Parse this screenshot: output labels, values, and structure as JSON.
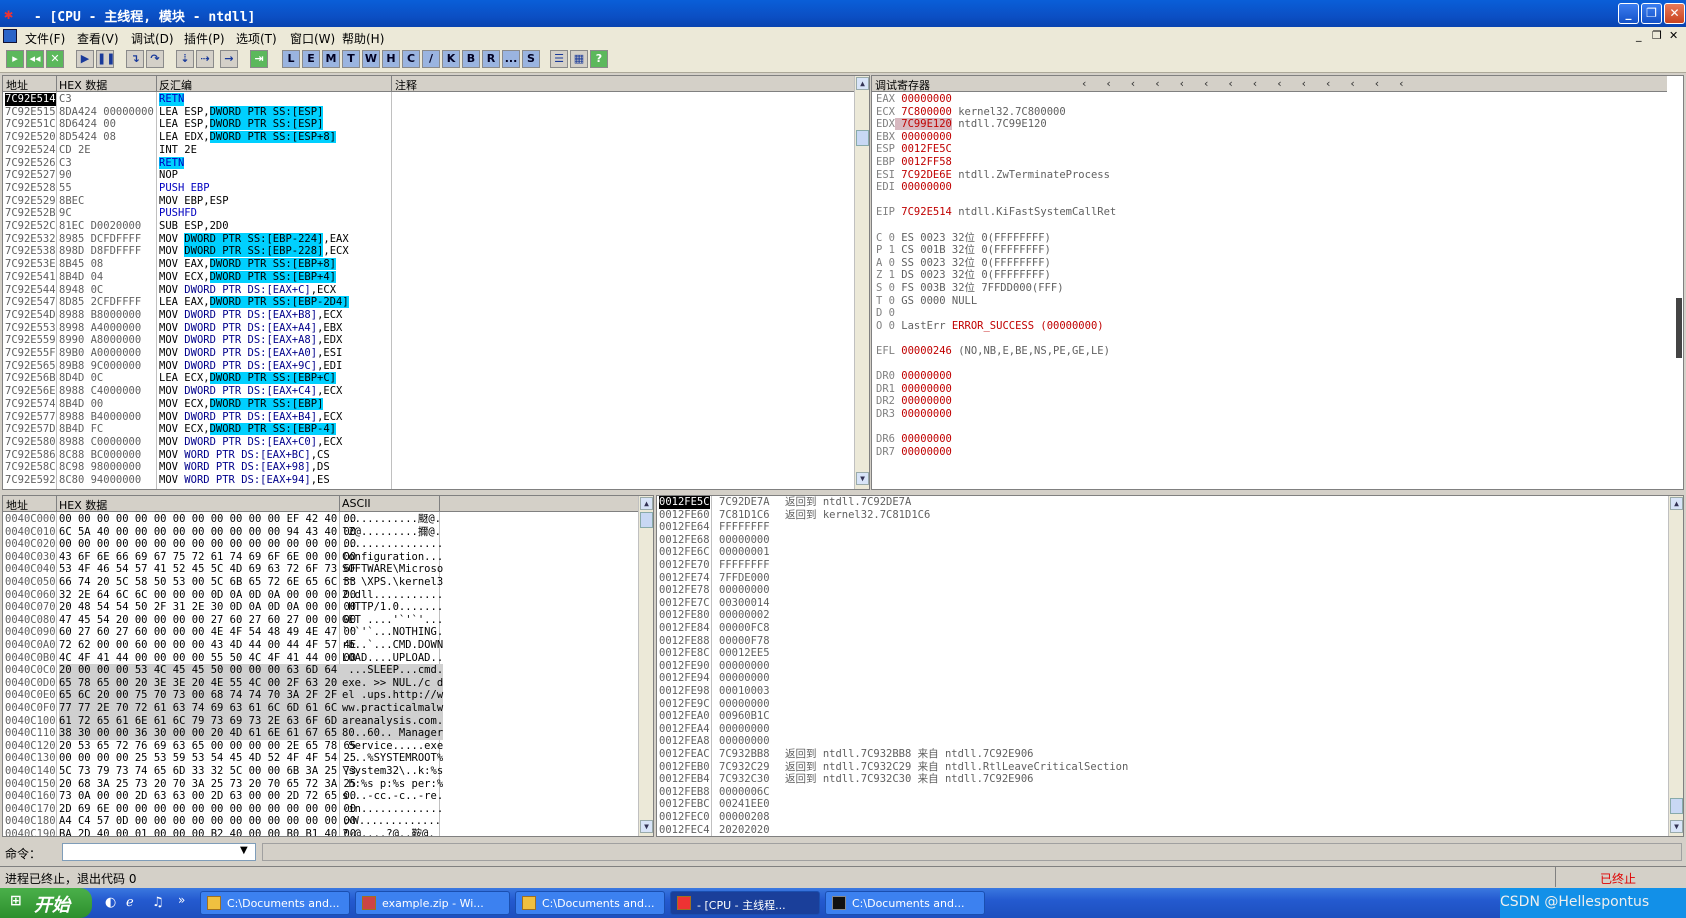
{
  "window": {
    "title": " - [CPU - 主线程, 模块 - ntdll]"
  },
  "menu": [
    "文件(F)",
    "查看(V)",
    "调试(D)",
    "插件(P)",
    "选项(T)",
    "窗口(W)",
    "帮助(H)"
  ],
  "toolbar_letters": [
    "L",
    "E",
    "M",
    "T",
    "W",
    "H",
    "C",
    "/",
    "K",
    "B",
    "R",
    "...",
    "S"
  ],
  "disasm": {
    "headers": {
      "addr": "地址",
      "hex": "HEX 数据",
      "asm": "反汇编",
      "comment": "注释"
    },
    "rows": [
      [
        "7C92E514",
        "C3",
        "RETN"
      ],
      [
        "7C92E515",
        "8DA424 00000000",
        "LEA ESP,DWORD PTR SS:[ESP]"
      ],
      [
        "7C92E51C",
        "8D6424 00",
        "LEA ESP,DWORD PTR SS:[ESP]"
      ],
      [
        "7C92E520",
        "8D5424 08",
        "LEA EDX,DWORD PTR SS:[ESP+8]"
      ],
      [
        "7C92E524",
        "CD 2E",
        "INT 2E"
      ],
      [
        "7C92E526",
        "C3",
        "RETN"
      ],
      [
        "7C92E527",
        "90",
        "NOP"
      ],
      [
        "7C92E528",
        "55",
        "PUSH EBP"
      ],
      [
        "7C92E529",
        "8BEC",
        "MOV EBP,ESP"
      ],
      [
        "7C92E52B",
        "9C",
        "PUSHFD"
      ],
      [
        "7C92E52C",
        "81EC D0020000",
        "SUB ESP,2D0"
      ],
      [
        "7C92E532",
        "8985 DCFDFFFF",
        "MOV DWORD PTR SS:[EBP-224],EAX"
      ],
      [
        "7C92E538",
        "898D D8FDFFFF",
        "MOV DWORD PTR SS:[EBP-228],ECX"
      ],
      [
        "7C92E53E",
        "8B45 08",
        "MOV EAX,DWORD PTR SS:[EBP+8]"
      ],
      [
        "7C92E541",
        "8B4D 04",
        "MOV ECX,DWORD PTR SS:[EBP+4]"
      ],
      [
        "7C92E544",
        "8948 0C",
        "MOV DWORD PTR DS:[EAX+C],ECX"
      ],
      [
        "7C92E547",
        "8D85 2CFDFFFF",
        "LEA EAX,DWORD PTR SS:[EBP-2D4]"
      ],
      [
        "7C92E54D",
        "8988 B8000000",
        "MOV DWORD PTR DS:[EAX+B8],ECX"
      ],
      [
        "7C92E553",
        "8998 A4000000",
        "MOV DWORD PTR DS:[EAX+A4],EBX"
      ],
      [
        "7C92E559",
        "8990 A8000000",
        "MOV DWORD PTR DS:[EAX+A8],EDX"
      ],
      [
        "7C92E55F",
        "89B0 A0000000",
        "MOV DWORD PTR DS:[EAX+A0],ESI"
      ],
      [
        "7C92E565",
        "89B8 9C000000",
        "MOV DWORD PTR DS:[EAX+9C],EDI"
      ],
      [
        "7C92E56B",
        "8D4D 0C",
        "LEA ECX,DWORD PTR SS:[EBP+C]"
      ],
      [
        "7C92E56E",
        "8988 C4000000",
        "MOV DWORD PTR DS:[EAX+C4],ECX"
      ],
      [
        "7C92E574",
        "8B4D 00",
        "MOV ECX,DWORD PTR SS:[EBP]"
      ],
      [
        "7C92E577",
        "8988 B4000000",
        "MOV DWORD PTR DS:[EAX+B4],ECX"
      ],
      [
        "7C92E57D",
        "8B4D FC",
        "MOV ECX,DWORD PTR SS:[EBP-4]"
      ],
      [
        "7C92E580",
        "8988 C0000000",
        "MOV DWORD PTR DS:[EAX+C0],ECX"
      ],
      [
        "7C92E586",
        "8C88 BC000000",
        "MOV WORD PTR DS:[EAX+BC],CS"
      ],
      [
        "7C92E58C",
        "8C98 98000000",
        "MOV WORD PTR DS:[EAX+98],DS"
      ],
      [
        "7C92E592",
        "8C80 94000000",
        "MOV WORD PTR DS:[EAX+94],ES"
      ]
    ]
  },
  "registers": {
    "header": "调试寄存器",
    "rows": [
      [
        "EAX",
        "00000000",
        ""
      ],
      [
        "ECX",
        "7C800000",
        "kernel32.7C800000"
      ],
      [
        "EDX",
        "7C99E120",
        "ntdll.7C99E120"
      ],
      [
        "EBX",
        "00000000",
        ""
      ],
      [
        "ESP",
        "0012FE5C",
        ""
      ],
      [
        "EBP",
        "0012FF58",
        ""
      ],
      [
        "ESI",
        "7C92DE6E",
        "ntdll.ZwTerminateProcess"
      ],
      [
        "EDI",
        "00000000",
        ""
      ],
      [
        "",
        "",
        " "
      ],
      [
        "EIP",
        "7C92E514",
        "ntdll.KiFastSystemCallRet"
      ],
      [
        "",
        "",
        " "
      ],
      [
        "C 0",
        "ES 0023",
        "32位 0(FFFFFFFF)"
      ],
      [
        "P 1",
        "CS 001B",
        "32位 0(FFFFFFFF)"
      ],
      [
        "A 0",
        "SS 0023",
        "32位 0(FFFFFFFF)"
      ],
      [
        "Z 1",
        "DS 0023",
        "32位 0(FFFFFFFF)"
      ],
      [
        "S 0",
        "FS 003B",
        "32位 7FFDD000(FFF)"
      ],
      [
        "T 0",
        "GS 0000",
        "NULL"
      ],
      [
        "D 0",
        "",
        ""
      ],
      [
        "O 0",
        "LastErr",
        "ERROR_SUCCESS (00000000)"
      ],
      [
        "",
        "",
        " "
      ],
      [
        "EFL",
        "00000246",
        "(NO,NB,E,BE,NS,PE,GE,LE)"
      ],
      [
        "",
        "",
        " "
      ],
      [
        "DR0",
        "00000000",
        ""
      ],
      [
        "DR1",
        "00000000",
        ""
      ],
      [
        "DR2",
        "00000000",
        ""
      ],
      [
        "DR3",
        "00000000",
        ""
      ],
      [
        "",
        "",
        " "
      ],
      [
        "DR6",
        "00000000",
        ""
      ],
      [
        "DR7",
        "00000000",
        ""
      ]
    ]
  },
  "dump": {
    "headers": {
      "addr": "地址",
      "hex": "HEX 数据",
      "ascii": "ASCII"
    },
    "rows": [
      [
        "0040C000",
        "00 00 00 00 00 00 00 00 00 00 00 00 EF 42 40 00",
        "............颬@."
      ],
      [
        "0040C010",
        "6C 5A 40 00 00 00 00 00 00 00 00 00 94 43 40 00",
        "lZ@.........擟@."
      ],
      [
        "0040C020",
        "00 00 00 00 00 00 00 00 00 00 00 00 00 00 00 00",
        "................"
      ],
      [
        "0040C030",
        "43 6F 6E 66 69 67 75 72 61 74 69 6F 6E 00 00 00",
        "Configuration..."
      ],
      [
        "0040C040",
        "53 4F 46 54 57 41 52 45 5C 4D 69 63 72 6F 73 6F",
        "SOFTWARE\\Microso"
      ],
      [
        "0040C050",
        "66 74 20 5C 58 50 53 00 5C 6B 65 72 6E 65 6C 33",
        "ft \\XPS.\\kernel3"
      ],
      [
        "0040C060",
        "32 2E 64 6C 6C 00 00 00 0D 0A 0D 0A 00 00 00 00",
        "2.dll..........."
      ],
      [
        "0040C070",
        "20 48 54 54 50 2F 31 2E 30 0D 0A 0D 0A 00 00 00",
        " HTTP/1.0......."
      ],
      [
        "0040C080",
        "47 45 54 20 00 00 00 00 27 60 27 60 27 00 00 00",
        "GET ....'`'`'..."
      ],
      [
        "0040C090",
        "60 27 60 27 60 00 00 00 4E 4F 54 48 49 4E 47 00",
        "`'`'`...NOTHING."
      ],
      [
        "0040C0A0",
        "72 62 00 00 60 00 00 00 43 4D 44 00 44 4F 57 4E",
        "rb..`...CMD.DOWN"
      ],
      [
        "0040C0B0",
        "4C 4F 41 44 00 00 00 00 55 50 4C 4F 41 44 00 00",
        "LOAD....UPLOAD.."
      ],
      [
        "0040C0C0",
        "20 00 00 00 53 4C 45 45 50 00 00 00 63 6D 64 2E",
        " ...SLEEP...cmd."
      ],
      [
        "0040C0D0",
        "65 78 65 00 20 3E 3E 20 4E 55 4C 00 2F 63 20 64",
        "exe. >> NUL./c d"
      ],
      [
        "0040C0E0",
        "65 6C 20 00 75 70 73 00 68 74 74 70 3A 2F 2F 77",
        "el .ups.http://w"
      ],
      [
        "0040C0F0",
        "77 77 2E 70 72 61 63 74 69 63 61 6C 6D 61 6C 77",
        "ww.practicalmalw"
      ],
      [
        "0040C100",
        "61 72 65 61 6E 61 6C 79 73 69 73 2E 63 6F 6D 00",
        "areanalysis.com."
      ],
      [
        "0040C110",
        "38 30 00 00 36 30 00 00 20 4D 61 6E 61 67 65 72",
        "80..60.. Manager"
      ],
      [
        "0040C120",
        "20 53 65 72 76 69 63 65 00 00 00 00 2E 65 78 65",
        " Service.....exe"
      ],
      [
        "0040C130",
        "00 00 00 00 25 53 59 53 54 45 4D 52 4F 4F 54 25",
        "....%SYSTEMROOT%"
      ],
      [
        "0040C140",
        "5C 73 79 73 74 65 6D 33 32 5C 00 00 6B 3A 25 73",
        "\\system32\\..k:%s"
      ],
      [
        "0040C150",
        "20 68 3A 25 73 20 70 3A 25 73 20 70 65 72 3A 25",
        " h:%s p:%s per:%"
      ],
      [
        "0040C160",
        "73 0A 00 00 2D 63 63 00 2D 63 00 00 2D 72 65 00",
        "s...-cc.-c..-re."
      ],
      [
        "0040C170",
        "2D 69 6E 00 00 00 00 00 00 00 00 00 00 00 00 00",
        "-in............."
      ],
      [
        "0040C180",
        "A4 C4 57 0D 00 00 00 00 00 00 00 00 00 00 00 00",
        "ぃW............."
      ],
      [
        "0040C190",
        "BA 2D 40 00 01 00 00 00 B2 40 00 00 B0 B1 40 00",
        "?-@....?@..鞍@."
      ]
    ]
  },
  "stack": {
    "rows": [
      [
        "0012FE5C",
        "7C92DE7A",
        "返回到 ntdll.7C92DE7A"
      ],
      [
        "0012FE60",
        "7C81D1C6",
        "返回到 kernel32.7C81D1C6"
      ],
      [
        "0012FE64",
        "FFFFFFFF",
        ""
      ],
      [
        "0012FE68",
        "00000000",
        ""
      ],
      [
        "0012FE6C",
        "00000001",
        ""
      ],
      [
        "0012FE70",
        "FFFFFFFF",
        ""
      ],
      [
        "0012FE74",
        "7FFDE000",
        ""
      ],
      [
        "0012FE78",
        "00000000",
        ""
      ],
      [
        "0012FE7C",
        "00300014",
        ""
      ],
      [
        "0012FE80",
        "00000002",
        ""
      ],
      [
        "0012FE84",
        "00000FC8",
        ""
      ],
      [
        "0012FE88",
        "00000F78",
        ""
      ],
      [
        "0012FE8C",
        "00012EE5",
        ""
      ],
      [
        "0012FE90",
        "00000000",
        ""
      ],
      [
        "0012FE94",
        "00000000",
        ""
      ],
      [
        "0012FE98",
        "00010003",
        ""
      ],
      [
        "0012FE9C",
        "00000000",
        ""
      ],
      [
        "0012FEA0",
        "00960B1C",
        ""
      ],
      [
        "0012FEA4",
        "00000000",
        ""
      ],
      [
        "0012FEA8",
        "00000000",
        ""
      ],
      [
        "0012FEAC",
        "7C932BB8",
        "返回到 ntdll.7C932BB8 来自 ntdll.7C92E906"
      ],
      [
        "0012FEB0",
        "7C932C29",
        "返回到 ntdll.7C932C29 来自 ntdll.RtlLeaveCriticalSection"
      ],
      [
        "0012FEB4",
        "7C932C30",
        "返回到 ntdll.7C932C30 来自 ntdll.7C92E906"
      ],
      [
        "0012FEB8",
        "0000006C",
        ""
      ],
      [
        "0012FEBC",
        "00241EE0",
        ""
      ],
      [
        "0012FEC0",
        "00000208",
        ""
      ],
      [
        "0012FEC4",
        "20202020",
        ""
      ]
    ]
  },
  "command": {
    "label": "命令：",
    "value": ""
  },
  "status": {
    "text": "进程已终止，退出代码 0",
    "state": "已终止"
  },
  "taskbar": {
    "start": "开始",
    "tasks": [
      "C:\\Documents and...",
      "example.zip - Wi...",
      "C:\\Documents and...",
      "- [CPU - 主线程...",
      "C:\\Documents and..."
    ],
    "watermark": "CSDN @Hellespontus"
  }
}
